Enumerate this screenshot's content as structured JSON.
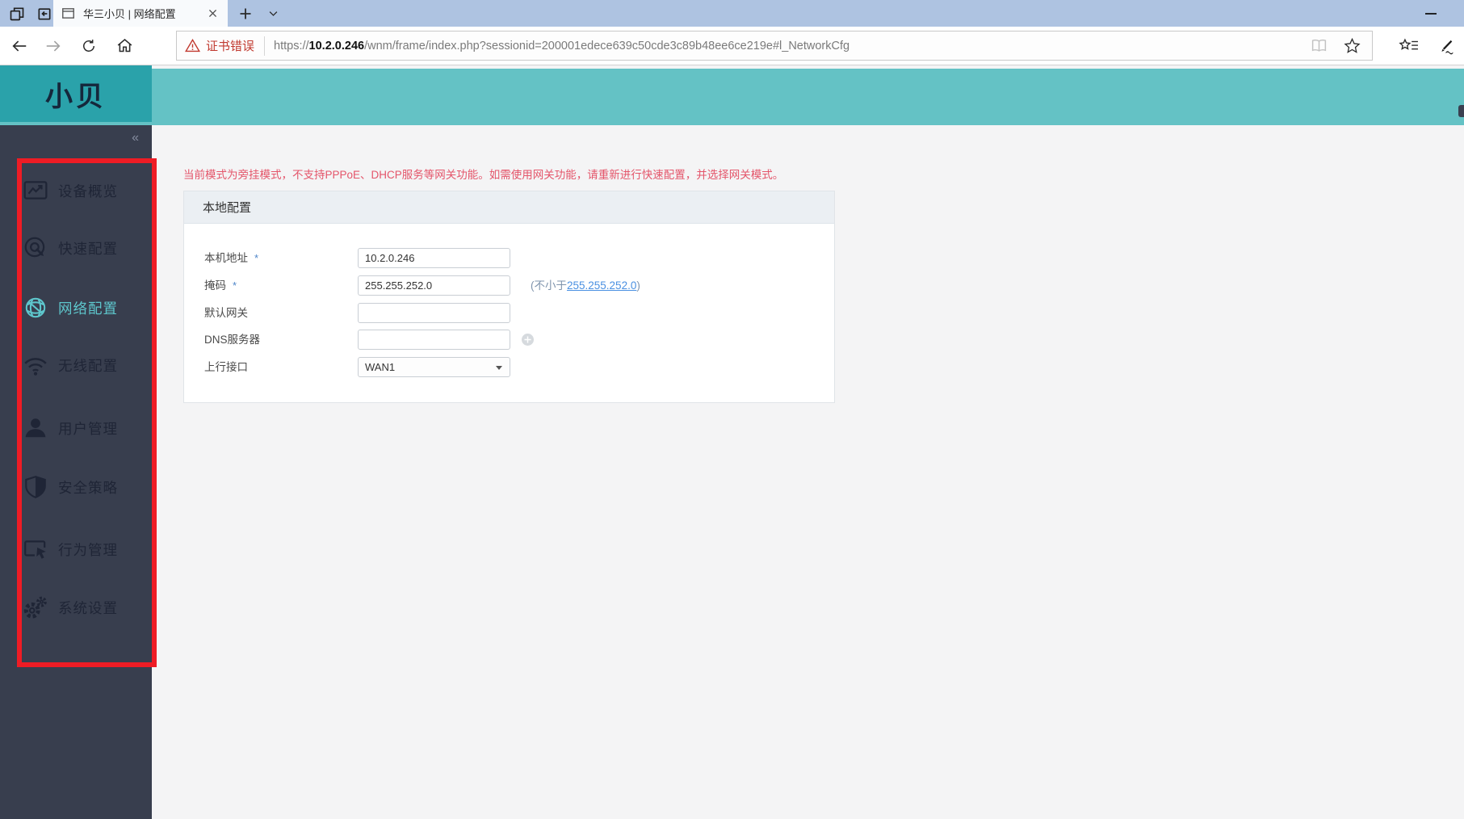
{
  "browser": {
    "tab_title": "华三小贝 | 网络配置",
    "cert_warning": "证书错误",
    "url": {
      "scheme": "https://",
      "host": "10.2.0.246",
      "path": "/wnm/frame/index.php?sessionid=200001edece639c50cde3c89b48ee6ce219e#l_NetworkCfg"
    }
  },
  "header": {
    "logo_text": "小贝"
  },
  "sidebar": {
    "collapse_glyph": "«",
    "items": [
      {
        "label": "设备概览",
        "icon": "chart-icon",
        "active": false
      },
      {
        "label": "快速配置",
        "icon": "quick-config-icon",
        "active": false
      },
      {
        "label": "网络配置",
        "icon": "globe-icon",
        "active": true
      },
      {
        "label": "无线配置",
        "icon": "wifi-icon",
        "active": false
      },
      {
        "label": "用户管理",
        "icon": "user-icon",
        "active": false
      },
      {
        "label": "安全策略",
        "icon": "shield-icon",
        "active": false
      },
      {
        "label": "行为管理",
        "icon": "behavior-icon",
        "active": false
      },
      {
        "label": "系统设置",
        "icon": "gears-icon",
        "active": false
      }
    ]
  },
  "content": {
    "mode_warning": "当前模式为旁挂模式，不支持PPPoE、DHCP服务等网关功能。如需使用网关功能，请重新进行快速配置，并选择网关模式。",
    "panel": {
      "title": "本地配置",
      "rows": [
        {
          "label": "本机地址",
          "required": "*",
          "value": "10.2.0.246"
        },
        {
          "label": "掩码",
          "required": "*",
          "value": "255.255.252.0",
          "hint_prefix": "(不小于",
          "hint_link": "255.255.252.0",
          "hint_suffix": ")"
        },
        {
          "label": "默认网关",
          "value": ""
        },
        {
          "label": "DNS服务器",
          "value": ""
        },
        {
          "label": "上行接口",
          "value": "WAN1"
        }
      ]
    }
  },
  "colors": {
    "header_teal": "#64c2c5",
    "logo_teal": "#2aa2aa",
    "sidebar_dark": "#383e4e",
    "active_item_teal": "#5ec7cd",
    "annotation_red": "#ee1c25",
    "warning_text_red": "#e4556a",
    "link_blue": "#4a90e2",
    "cert_error_red": "#c13a30"
  }
}
